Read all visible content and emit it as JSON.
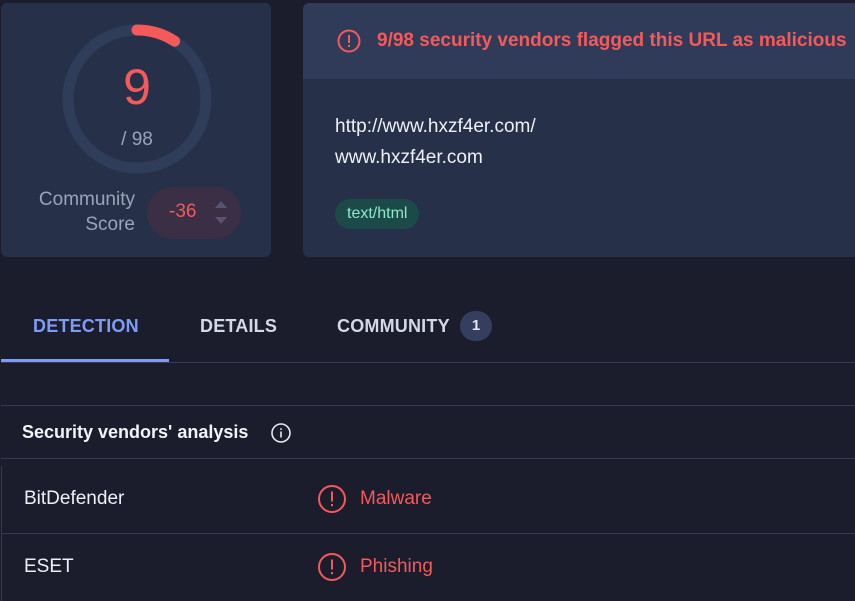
{
  "score": {
    "detections": "9",
    "total": "/ 98",
    "detections_value": 9,
    "total_value": 98,
    "community_label": "Community Score",
    "community_score": "-36"
  },
  "alert": {
    "text": "9/98 security vendors flagged this URL as malicious",
    "icon": "alert-circle-icon",
    "color": "#f45a5a"
  },
  "url": {
    "full": "http://www.hxzf4er.com/",
    "domain": "www.hxzf4er.com",
    "content_type_tag": "text/html"
  },
  "tabs": [
    {
      "label": "DETECTION",
      "active": true
    },
    {
      "label": "DETAILS",
      "active": false
    },
    {
      "label": "COMMUNITY",
      "active": false,
      "badge": "1"
    }
  ],
  "section": {
    "title": "Security vendors' analysis"
  },
  "vendors": [
    {
      "name": "BitDefender",
      "verdict": "Malware"
    },
    {
      "name": "ESET",
      "verdict": "Phishing"
    }
  ],
  "colors": {
    "accent": "#7f9cf5",
    "danger": "#f45a5a",
    "card": "#263149",
    "background": "#1b1c2c"
  }
}
